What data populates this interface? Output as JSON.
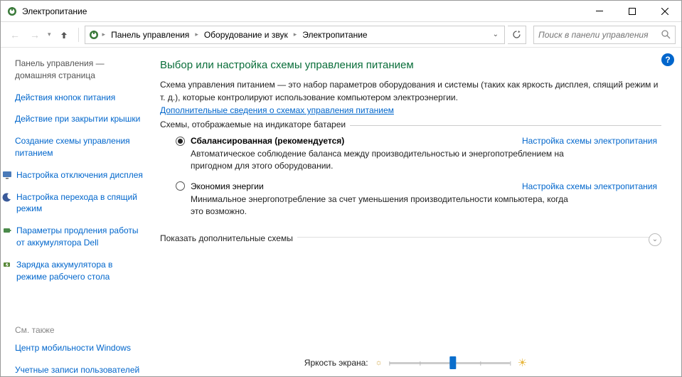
{
  "window": {
    "title": "Электропитание"
  },
  "breadcrumb": {
    "items": [
      "Панель управления",
      "Оборудование и звук",
      "Электропитание"
    ]
  },
  "search": {
    "placeholder": "Поиск в панели управления"
  },
  "sidebar": {
    "home": "Панель управления — домашняя страница",
    "links": [
      "Действия кнопок питания",
      "Действие при закрытии крышки",
      "Создание схемы управления питанием"
    ],
    "icon_links": [
      {
        "label": "Настройка отключения дисплея",
        "icon": "monitor-icon"
      },
      {
        "label": "Настройка перехода в спящий режим",
        "icon": "moon-icon"
      },
      {
        "label": "Параметры продления работы от аккумулятора Dell",
        "icon": "battery-icon"
      },
      {
        "label": "Зарядка аккумулятора в режиме рабочего стола",
        "icon": "charge-icon"
      }
    ],
    "see_also_title": "См. также",
    "see_also": [
      "Центр мобильности Windows",
      "Учетные записи пользователей"
    ]
  },
  "main": {
    "heading": "Выбор или настройка схемы управления питанием",
    "description": "Схема управления питанием — это набор параметров оборудования и системы (таких как яркость дисплея, спящий режим и т. д.), которые контролируют использование компьютером электроэнергии.",
    "more_link": "Дополнительные сведения о схемах управления питанием",
    "fieldset_legend": "Схемы, отображаемые на индикаторе батареи",
    "plans": [
      {
        "name": "Сбалансированная (рекомендуется)",
        "selected": true,
        "link": "Настройка схемы электропитания",
        "desc": "Автоматическое соблюдение баланса между производительностью и энергопотреблением на пригодном для этого оборудовании."
      },
      {
        "name": "Экономия энергии",
        "selected": false,
        "link": "Настройка схемы электропитания",
        "desc": "Минимальное энергопотребление за счет уменьшения производительности компьютера, когда это возможно."
      }
    ],
    "expander_label": "Показать дополнительные схемы"
  },
  "slider": {
    "label": "Яркость экрана:",
    "value_pct": 50
  }
}
